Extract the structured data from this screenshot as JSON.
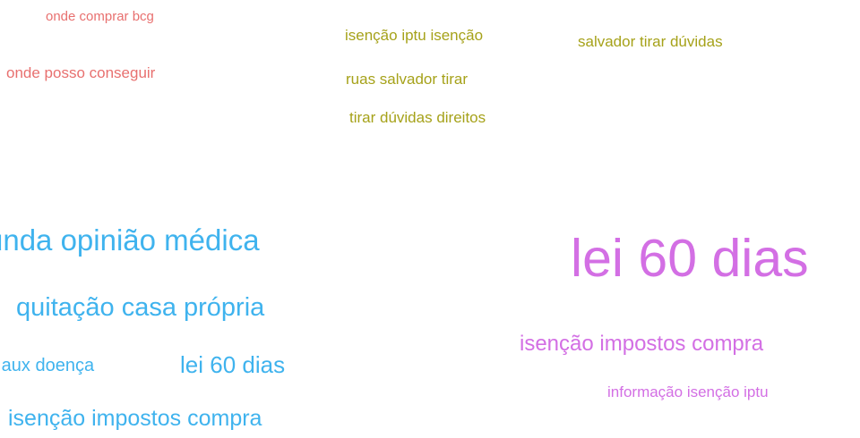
{
  "cloud": {
    "group_red": {
      "color": "#e8706f",
      "terms": [
        "onde comprar bcg",
        "onde posso conseguir"
      ]
    },
    "group_olive": {
      "color": "#a6a21a",
      "terms": [
        "isenção iptu isenção",
        "salvador tirar dúvidas",
        "ruas salvador tirar",
        "tirar dúvidas direitos"
      ]
    },
    "group_blue": {
      "color": "#3fb3ee",
      "terms": [
        "unda opinião médica",
        "quitação casa própria",
        "o aux doença",
        "lei 60 dias",
        "isenção impostos compra"
      ]
    },
    "group_magenta": {
      "color": "#d36fe4",
      "terms": [
        "lei 60 dias",
        "isenção impostos compra",
        "informação isenção iptu"
      ]
    }
  }
}
